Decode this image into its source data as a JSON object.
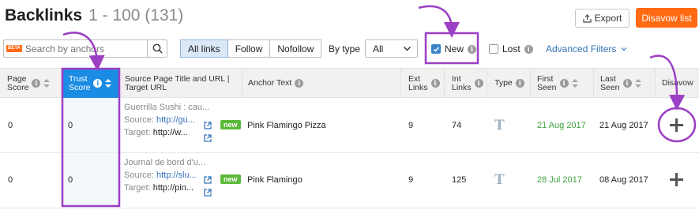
{
  "header": {
    "title": "Backlinks",
    "range": "1 - 100 (131)",
    "export_label": "Export",
    "disavow_list_label": "Disavow list"
  },
  "filters": {
    "beta_label": "BETA",
    "search_placeholder": "Search by anchors",
    "link_tabs": [
      "All links",
      "Follow",
      "Nofollow"
    ],
    "active_tab": "All links",
    "by_type_label": "By type",
    "type_value": "All",
    "new_label": "New",
    "new_checked": true,
    "lost_label": "Lost",
    "lost_checked": false,
    "advanced_label": "Advanced Filters"
  },
  "columns": {
    "page_score": [
      "Page",
      "Score"
    ],
    "trust_score": [
      "Trust",
      "Score"
    ],
    "source": [
      "Source Page Title and URL |",
      "Target URL"
    ],
    "anchor": "Anchor Text",
    "ext_links": [
      "Ext",
      "Links"
    ],
    "int_links": [
      "Int",
      "Links"
    ],
    "type": "Type",
    "first_seen": [
      "First",
      "Seen"
    ],
    "last_seen": [
      "Last",
      "Seen"
    ],
    "disavow": "Disavow"
  },
  "rows": [
    {
      "page_score": "0",
      "trust_score": "0",
      "title": "Guerrilla Sushi : cau...",
      "source_label": "Source:",
      "source_url": "http://gu...",
      "target_label": "Target:",
      "target_url": "http://w...",
      "badge": "new",
      "anchor": "Pink Flamingo Pizza",
      "ext": "9",
      "int": "74",
      "type": "T",
      "first_seen": "21 Aug 2017",
      "last_seen": "21 Aug 2017"
    },
    {
      "page_score": "0",
      "trust_score": "0",
      "title": "Journal de bord d'u...",
      "source_label": "Source:",
      "source_url": "http://slu...",
      "target_label": "Target:",
      "target_url": "http://pin...",
      "badge": "new",
      "anchor": "Pink Flamingo",
      "ext": "9",
      "int": "125",
      "type": "T",
      "first_seen": "28 Jul 2017",
      "last_seen": "08 Aug 2017"
    }
  ],
  "colors": {
    "accent": "#ff6a13",
    "trust_header": "#1a8ce4",
    "annotation": "#9b3fc4",
    "link": "#3474bb",
    "green": "#3ea13a"
  }
}
